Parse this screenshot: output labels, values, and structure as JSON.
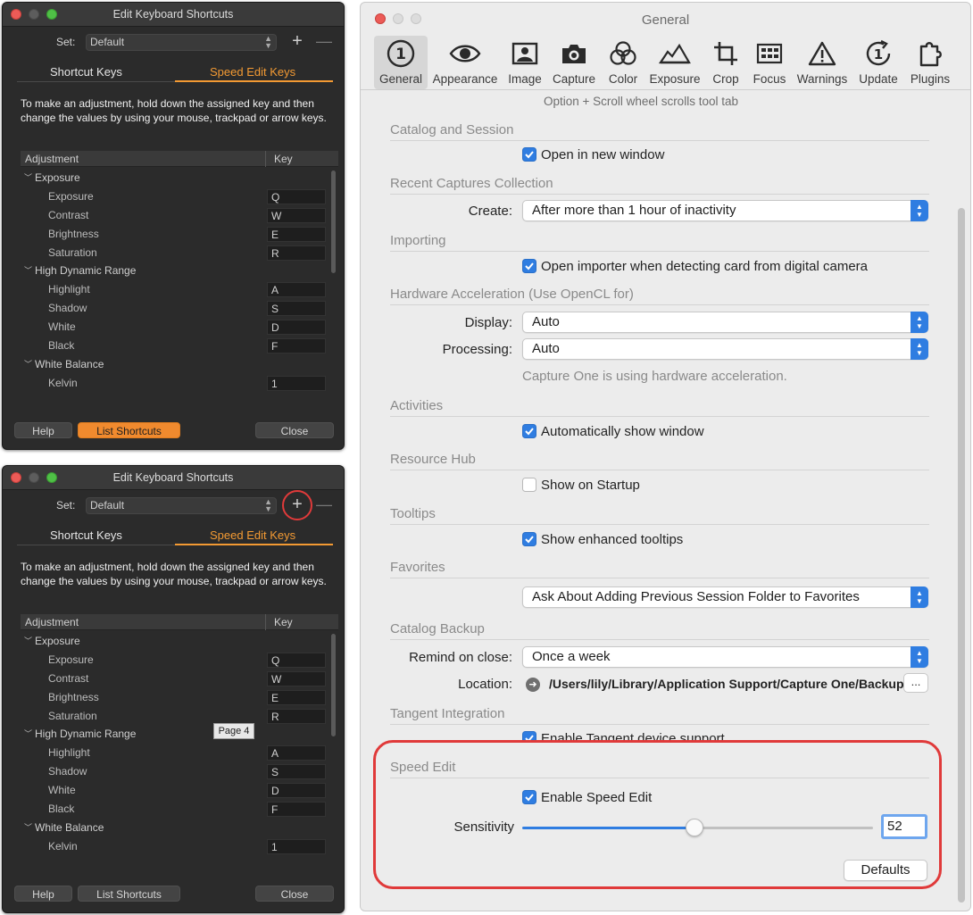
{
  "kb_panel": {
    "title": "Edit Keyboard Shortcuts",
    "set_label": "Set:",
    "set_value": "Default",
    "tab_shortcut": "Shortcut Keys",
    "tab_speed": "Speed Edit Keys",
    "description": "To make an adjustment, hold down the assigned key and then change the values by using your mouse, trackpad or arrow keys.",
    "col_adjustment": "Adjustment",
    "col_key": "Key",
    "rows": [
      {
        "group": "Exposure"
      },
      {
        "label": "Exposure",
        "key": "Q"
      },
      {
        "label": "Contrast",
        "key": "W"
      },
      {
        "label": "Brightness",
        "key": "E"
      },
      {
        "label": "Saturation",
        "key": "R"
      },
      {
        "group": "High Dynamic Range"
      },
      {
        "label": "Highlight",
        "key": "A"
      },
      {
        "label": "Shadow",
        "key": "S"
      },
      {
        "label": "White",
        "key": "D"
      },
      {
        "label": "Black",
        "key": "F"
      },
      {
        "group": "White Balance"
      },
      {
        "label": "Kelvin",
        "key": "1"
      }
    ],
    "btn_help": "Help",
    "btn_list": "List Shortcuts",
    "btn_close": "Close",
    "tooltip": "Page 4",
    "plus": "+",
    "minus": "—"
  },
  "general": {
    "title": "General",
    "toolbar": [
      {
        "label": "General",
        "icon": "info-circle-icon"
      },
      {
        "label": "Appearance",
        "icon": "eye-icon"
      },
      {
        "label": "Image",
        "icon": "image-icon"
      },
      {
        "label": "Capture",
        "icon": "camera-icon"
      },
      {
        "label": "Color",
        "icon": "color-circles-icon"
      },
      {
        "label": "Exposure",
        "icon": "exposure-icon"
      },
      {
        "label": "Crop",
        "icon": "crop-icon"
      },
      {
        "label": "Focus",
        "icon": "focus-icon"
      },
      {
        "label": "Warnings",
        "icon": "warning-icon"
      },
      {
        "label": "Update",
        "icon": "update-icon"
      },
      {
        "label": "Plugins",
        "icon": "puzzle-icon"
      }
    ],
    "hint": "Option + Scroll wheel scrolls tool tab",
    "catalog_session": "Catalog and Session",
    "open_new_window": "Open in new window",
    "recent_captures": "Recent Captures Collection",
    "create_label": "Create:",
    "create_value": "After more than 1 hour of inactivity",
    "importing": "Importing",
    "open_importer": "Open importer when detecting card from digital camera",
    "hw_accel": "Hardware Acceleration (Use OpenCL for)",
    "display_label": "Display:",
    "display_value": "Auto",
    "processing_label": "Processing:",
    "processing_value": "Auto",
    "hw_note": "Capture One is using hardware acceleration.",
    "activities": "Activities",
    "auto_show": "Automatically show window",
    "resource_hub": "Resource Hub",
    "show_startup": "Show on Startup",
    "tooltips": "Tooltips",
    "show_tooltips": "Show enhanced tooltips",
    "favorites": "Favorites",
    "favorites_value": "Ask About Adding Previous Session Folder to Favorites",
    "catalog_backup": "Catalog Backup",
    "remind_label": "Remind on close:",
    "remind_value": "Once a week",
    "location_label": "Location:",
    "location_value": "/Users/lily/Library/Application Support/Capture One/Backups",
    "location_btn": "...",
    "tangent": "Tangent Integration",
    "tangent_enable": "Enable Tangent device support",
    "speed_edit": "Speed Edit",
    "enable_speed": "Enable Speed Edit",
    "sensitivity_label": "Sensitivity",
    "sensitivity_value": "52",
    "sensitivity_fraction": 0.49,
    "defaults_btn": "Defaults"
  },
  "colors": {
    "accent_blue": "#2f7de1",
    "accent_orange": "#f39a33",
    "highlight_red": "#e03a3a"
  }
}
